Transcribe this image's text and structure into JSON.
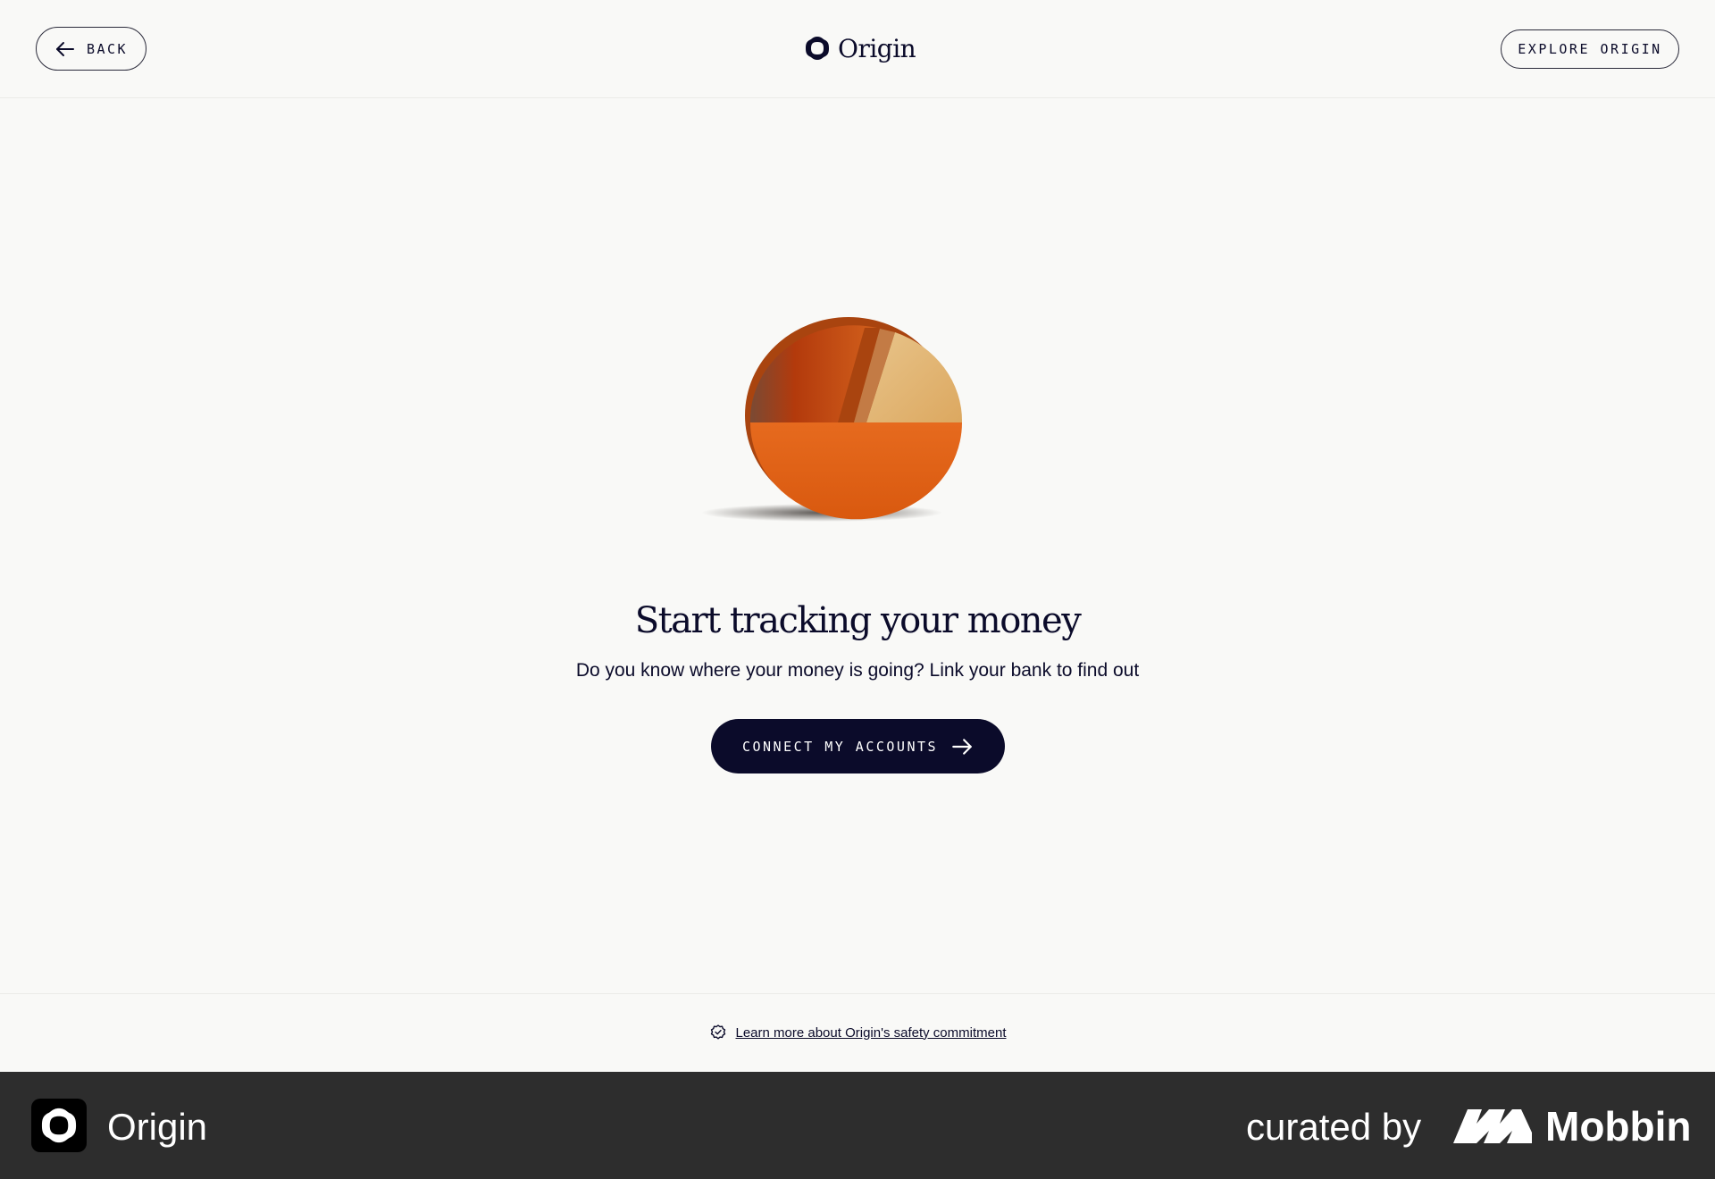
{
  "header": {
    "back_label": "BACK",
    "logo_text": "Origin",
    "explore_label": "EXPLORE ORIGIN"
  },
  "main": {
    "title": "Start tracking your money",
    "subtitle": "Do you know where your money is going? Link your bank to find out",
    "cta_label": "CONNECT MY ACCOUNTS"
  },
  "footer": {
    "safety_link": "Learn more about Origin's safety commitment"
  },
  "bottom_bar": {
    "app_name": "Origin",
    "curated_label": "curated by",
    "brand_name": "Mobbin"
  },
  "colors": {
    "background": "#f9f9f7",
    "primary": "#0b0b2a",
    "bottom_bar": "#2d2d2d",
    "pie_orange": "#e1631a",
    "pie_dark": "#b8420e",
    "pie_tan": "#e3b770"
  },
  "icons": {
    "back": "arrow-left-icon",
    "logo": "origin-logo-icon",
    "cta": "arrow-right-icon",
    "safety": "shield-check-icon",
    "mobbin": "mobbin-logo-icon"
  }
}
